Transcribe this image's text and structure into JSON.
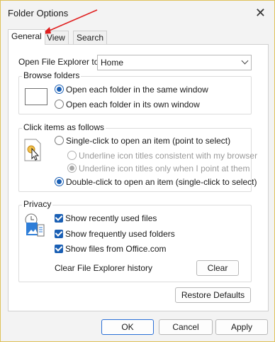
{
  "window": {
    "title": "Folder Options",
    "close_glyph": "✕"
  },
  "tabs": [
    {
      "label": "General"
    },
    {
      "label": "View"
    },
    {
      "label": "Search"
    }
  ],
  "open_explorer": {
    "label": "Open File Explorer to:",
    "value": "Home"
  },
  "browse": {
    "title": "Browse folders",
    "options": [
      {
        "label": "Open each folder in the same window",
        "selected": true
      },
      {
        "label": "Open each folder in its own window",
        "selected": false
      }
    ]
  },
  "click": {
    "title": "Click items as follows",
    "single": "Single-click to open an item (point to select)",
    "underline_consistent": "Underline icon titles consistent with my browser",
    "underline_point": "Underline icon titles only when I point at them",
    "double": "Double-click to open an item (single-click to select)"
  },
  "privacy": {
    "title": "Privacy",
    "checks": [
      {
        "label": "Show recently used files"
      },
      {
        "label": "Show frequently used folders"
      },
      {
        "label": "Show files from Office.com"
      }
    ],
    "clear_label": "Clear File Explorer history",
    "clear_button": "Clear"
  },
  "restore_button": "Restore Defaults",
  "footer": {
    "ok": "OK",
    "cancel": "Cancel",
    "apply": "Apply"
  },
  "colors": {
    "accent": "#1a5fb4",
    "annotation_arrow": "#e02020",
    "window_border": "#e0c25a"
  }
}
